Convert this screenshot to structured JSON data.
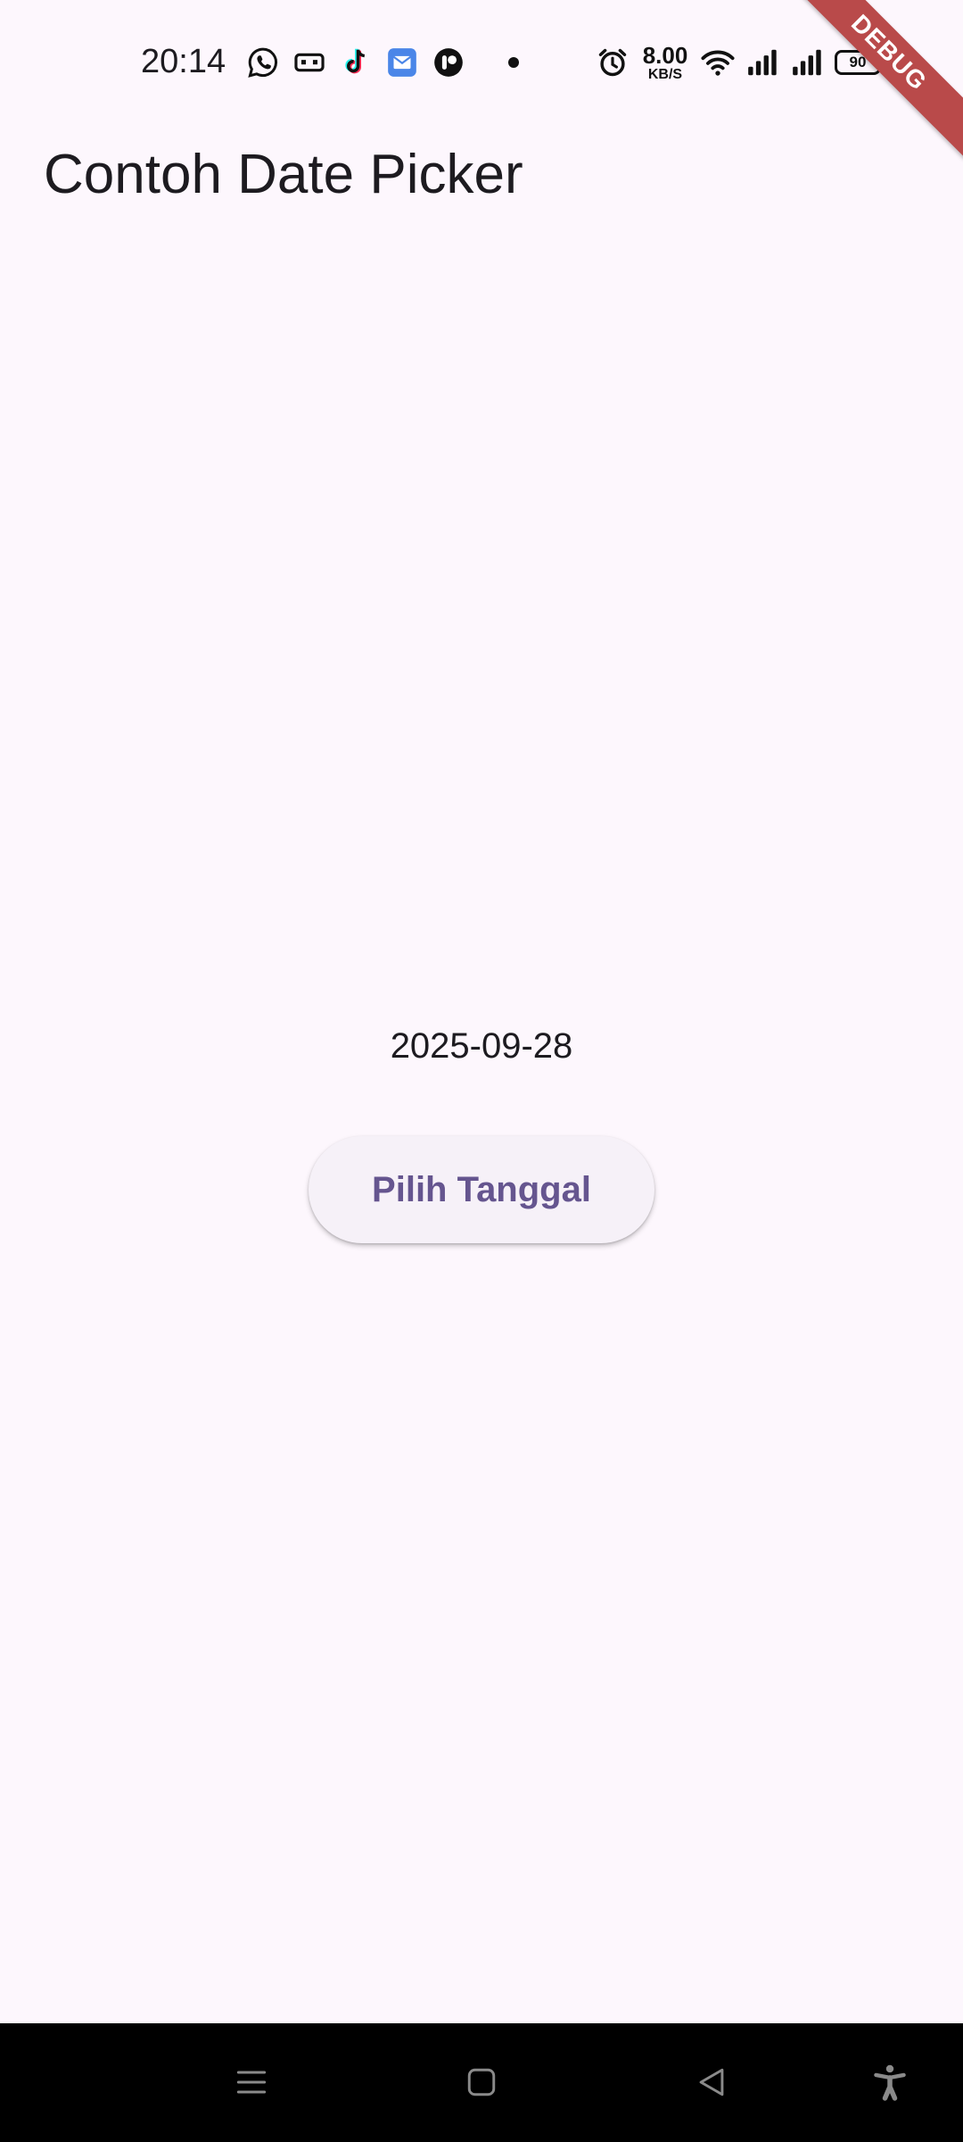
{
  "status_bar": {
    "time": "20:14",
    "net_speed_value": "8.00",
    "net_speed_unit": "KB/S",
    "battery_level": "90",
    "left_icons": [
      "whatsapp-icon",
      "voicemail-icon",
      "tiktok-icon",
      "mail-app-icon",
      "app-icon",
      "notification-dot"
    ],
    "right_icons": [
      "alarm-icon",
      "wifi-icon",
      "signal-icon",
      "signal-icon-2",
      "battery-icon"
    ]
  },
  "debug_banner": {
    "label": "DEBUG"
  },
  "app_bar": {
    "title": "Contoh Date Picker"
  },
  "main": {
    "selected_date": "2025-09-28",
    "pick_button_label": "Pilih Tanggal"
  },
  "nav_bar": {
    "buttons": [
      "menu-icon",
      "home-icon",
      "back-icon",
      "accessibility-icon"
    ]
  },
  "colors": {
    "background": "#fdf7fd",
    "button_bg": "#f6f1f8",
    "button_text": "#65558f",
    "debug_ribbon": "#b94a4a",
    "nav_bar": "#000000"
  }
}
